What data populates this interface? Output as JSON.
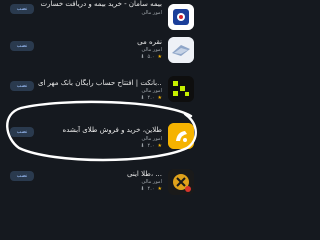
{
  "apps": [
    {
      "title": "بیمه سامان - خرید بیمه و دریافت خسارت",
      "category": "امور مالی",
      "rating": "۴.۰",
      "size": "",
      "install_label": "نصب",
      "icon": "saman-insurance-icon"
    },
    {
      "title": "نقره می",
      "category": "امور مالی",
      "rating": "۵.۰",
      "size": "",
      "install_label": "نصب",
      "icon": "noghreh-icon"
    },
    {
      "title": "بانکت | افتتاح حساب رایگان بانک مهر ای...",
      "category": "امور مالی",
      "rating": "۴.۰",
      "size": "",
      "install_label": "نصب",
      "icon": "banket-icon"
    },
    {
      "title": "طلاین، خرید و فروش طلای آبشده",
      "category": "امور مالی",
      "rating": "۴.۰",
      "size": "",
      "install_label": "نصب",
      "icon": "talain-icon"
    },
    {
      "title": "طلا اینی، ...",
      "category": "امور مالی",
      "rating": "۴.۰",
      "size": "",
      "install_label": "نصب",
      "icon": "gold-icon"
    }
  ]
}
